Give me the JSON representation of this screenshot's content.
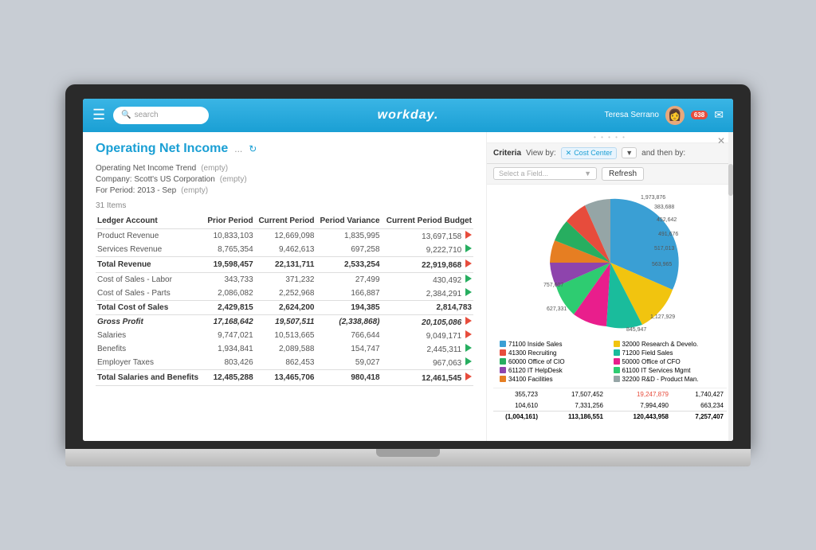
{
  "header": {
    "search_placeholder": "search",
    "logo": "workday.",
    "user_name": "Teresa Serrano",
    "notification_count": "638"
  },
  "page": {
    "title": "Operating Net Income",
    "title_meta_dots": "...",
    "meta": [
      {
        "label": "Operating Net Income Trend",
        "value": "(empty)"
      },
      {
        "label": "Company: Scott's US Corporation",
        "value": "(empty)"
      },
      {
        "label": "For Period: 2013 - Sep",
        "value": "(empty)"
      }
    ],
    "items_count": "31 Items",
    "table": {
      "headers": [
        "Ledger Account",
        "Prior Period",
        "Current Period",
        "Period Variance",
        "Current Period Budget"
      ],
      "rows": [
        {
          "account": "Product Revenue",
          "prior": "10,833,103",
          "current": "12,669,098",
          "variance": "1,835,995",
          "budget": "13,697,158",
          "variance_color": "red",
          "flag": "red"
        },
        {
          "account": "Services Revenue",
          "prior": "8,765,354",
          "current": "9,462,613",
          "variance": "697,258",
          "budget": "9,222,710",
          "variance_color": "red",
          "flag": "green"
        }
      ],
      "total_revenue": {
        "account": "Total Revenue",
        "prior": "19,598,457",
        "current": "22,131,711",
        "variance": "2,533,254",
        "budget": "22,919,868",
        "flag": "red"
      },
      "rows2": [
        {
          "account": "Cost of Sales - Labor",
          "prior": "343,733",
          "current": "371,232",
          "variance": "27,499",
          "budget": "430,492",
          "flag": "green"
        },
        {
          "account": "Cost of Sales - Parts",
          "prior": "2,086,082",
          "current": "2,252,968",
          "variance": "166,887",
          "budget": "2,384,291",
          "flag": "green"
        }
      ],
      "total_cost": {
        "account": "Total Cost of Sales",
        "prior": "2,429,815",
        "current": "2,624,200",
        "variance": "194,385",
        "budget": "2,814,783"
      },
      "gross_profit": {
        "account": "Gross Profit",
        "prior": "17,168,642",
        "current": "19,507,511",
        "variance": "(2,338,868)",
        "budget": "20,105,086",
        "flag": "red"
      },
      "rows3": [
        {
          "account": "Salaries",
          "prior": "9,747,021",
          "current": "10,513,665",
          "variance": "766,644",
          "budget": "9,049,171",
          "flag": "red"
        },
        {
          "account": "Benefits",
          "prior": "1,934,841",
          "current": "2,089,588",
          "variance": "154,747",
          "budget": "2,445,311",
          "flag": "green"
        },
        {
          "account": "Employer Taxes",
          "prior": "803,426",
          "current": "862,453",
          "variance": "59,027",
          "budget": "967,063",
          "flag": "green"
        }
      ],
      "total_salaries": {
        "account": "Total Salaries and Benefits",
        "prior": "12,485,288",
        "current": "13,465,706",
        "variance": "980,418",
        "budget": "12,461,545",
        "flag": "red"
      }
    },
    "extra_row": {
      "col1": "355,723",
      "col2": "17,507,452",
      "col3": "19,247,879",
      "col3_color": "red",
      "col4": "1,740,427",
      "col5": "104,610",
      "col6": "7,331,256",
      "col7": "7,994,490",
      "col8": "663,234",
      "total_row": "(1,004,161)",
      "total2": "113,186,551",
      "total3": "120,443,958",
      "total4": "7,257,407"
    }
  },
  "criteria": {
    "label": "Criteria",
    "view_by": "View by:",
    "cost_center_tag": "✕ Cost Center",
    "dropdown_arrow": "▼",
    "and_then_by": "and then by:",
    "field_placeholder": "Select a Field...",
    "field_arrow": "▼",
    "refresh_label": "Refresh"
  },
  "chart": {
    "labels": [
      "383,688",
      "452,642",
      "491,676",
      "517,013",
      "563,965",
      "627,331",
      "757,607",
      "845,947",
      "1,127,929",
      "1,973,876"
    ],
    "legend": [
      {
        "label": "71100 Inside Sales",
        "color": "#3a9fd4"
      },
      {
        "label": "41300 Recruiting",
        "color": "#e74c3c"
      },
      {
        "label": "60000 Office of CIO",
        "color": "#27ae60"
      },
      {
        "label": "61120 IT HelpDesk",
        "color": "#8e44ad"
      },
      {
        "label": "34100 Facilities",
        "color": "#e67e22"
      },
      {
        "label": "32000 Research & Develo.",
        "color": "#f1c40f"
      },
      {
        "label": "71200 Field Sales",
        "color": "#1abc9c"
      },
      {
        "label": "50000 Office of CFO",
        "color": "#e91e8c"
      },
      {
        "label": "61100 IT Services Mgmt",
        "color": "#2ecc71"
      },
      {
        "label": "32200 R&D - Product Man.",
        "color": "#95a5a6"
      }
    ]
  }
}
